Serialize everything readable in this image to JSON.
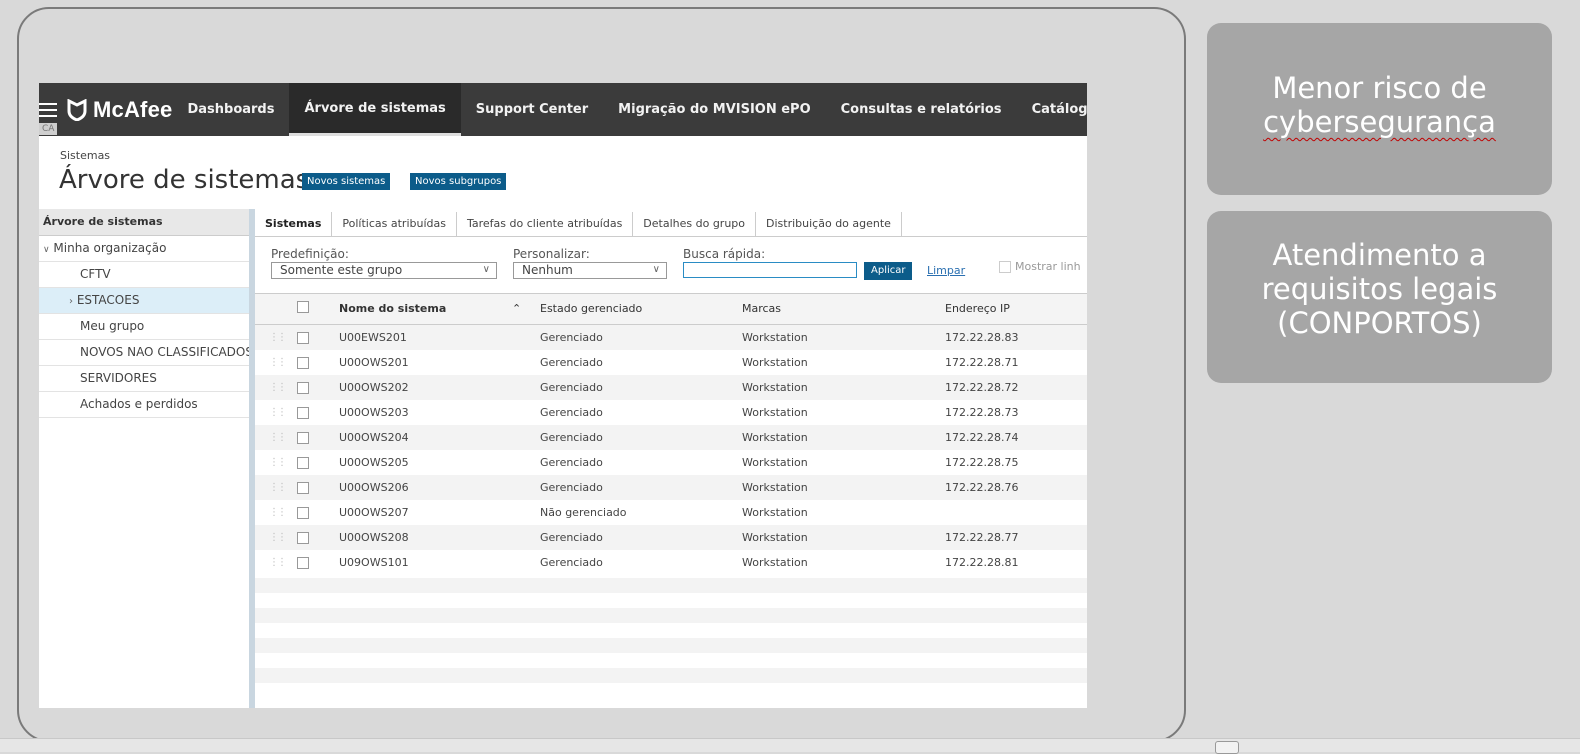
{
  "app": {
    "brand": "McAfee",
    "ca_tag": "CA",
    "nav": [
      "Dashboards",
      "Árvore de sistemas",
      "Support Center",
      "Migração do MVISION ePO",
      "Consultas e relatórios",
      "Catálog"
    ]
  },
  "page": {
    "breadcrumb": "Sistemas",
    "title": "Árvore de sistemas",
    "btn_new_systems": "Novos sistemas",
    "btn_new_subgroups": "Novos subgrupos"
  },
  "tree": {
    "header": "Árvore de sistemas",
    "root": "Minha organização",
    "items": [
      "CFTV",
      "ESTACOES",
      "Meu grupo",
      "NOVOS NAO CLASSIFICADOS",
      "SERVIDORES",
      "Achados e perdidos"
    ]
  },
  "tabs": [
    "Sistemas",
    "Políticas atribuídas",
    "Tarefas do cliente atribuídas",
    "Detalhes do grupo",
    "Distribuição do agente"
  ],
  "filters": {
    "preset_label": "Predefinição:",
    "preset_value": "Somente este grupo",
    "custom_label": "Personalizar:",
    "custom_value": "Nenhum",
    "search_label": "Busca rápida:",
    "search_value": "",
    "apply": "Aplicar",
    "clear": "Limpar",
    "show_rows": "Mostrar linh"
  },
  "table": {
    "columns": [
      "Nome do sistema",
      "Estado gerenciado",
      "Marcas",
      "Endereço IP"
    ],
    "rows": [
      [
        "U00EWS201",
        "Gerenciado",
        "Workstation",
        "172.22.28.83"
      ],
      [
        "U00OWS201",
        "Gerenciado",
        "Workstation",
        "172.22.28.71"
      ],
      [
        "U00OWS202",
        "Gerenciado",
        "Workstation",
        "172.22.28.72"
      ],
      [
        "U00OWS203",
        "Gerenciado",
        "Workstation",
        "172.22.28.73"
      ],
      [
        "U00OWS204",
        "Gerenciado",
        "Workstation",
        "172.22.28.74"
      ],
      [
        "U00OWS205",
        "Gerenciado",
        "Workstation",
        "172.22.28.75"
      ],
      [
        "U00OWS206",
        "Gerenciado",
        "Workstation",
        "172.22.28.76"
      ],
      [
        "U00OWS207",
        "Não gerenciado",
        "Workstation",
        ""
      ],
      [
        "U00OWS208",
        "Gerenciado",
        "Workstation",
        "172.22.28.77"
      ],
      [
        "U09OWS101",
        "Gerenciado",
        "Workstation",
        "172.22.28.81"
      ]
    ]
  },
  "cards": {
    "card1_line1": "Menor risco de",
    "card1_line2": "cybersegurança",
    "card2_line1": "Atendimento a",
    "card2_line2": "requisitos legais",
    "card2_line3": "(CONPORTOS)"
  },
  "colors": {
    "nav_bg": "#3b3b3b",
    "accent_blue": "#0c5c8a",
    "card_bg": "#a6a6a6",
    "slide_bg": "#d9d9d9"
  }
}
